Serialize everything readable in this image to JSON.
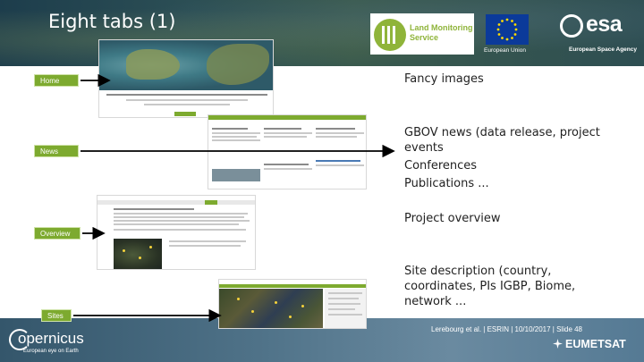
{
  "slide": {
    "title": "Eight tabs (1)"
  },
  "logos": {
    "land_monitoring_line1": "Land Monitoring",
    "land_monitoring_line2": "Service",
    "eu_caption": "European Union",
    "esa_text": "esa",
    "esa_caption": "European Space Agency",
    "copernicus_text": "opernicus",
    "copernicus_caption": "European eye on Earth",
    "eumetsat_text": "EUMETSAT"
  },
  "tabs": {
    "home": "Home",
    "news": "News",
    "overview": "Overview",
    "sites": "Sites"
  },
  "screenshots": {
    "home_heading": "Ground-Based Observations for Validation (GBOV) of Copernicus Global Land Products",
    "logo_label": "Copernicus"
  },
  "descriptions": {
    "home": "Fancy images",
    "news_line1": "GBOV news (data release, project",
    "news_line2": "events",
    "news_line3": "Conferences",
    "news_line4": "Publications ...",
    "overview": "Project overview",
    "sites_line1": "Site description (country,",
    "sites_line2": "coordinates, PIs IGBP, Biome,",
    "sites_line3": "network ..."
  },
  "footer": {
    "text": "Lerebourg et al. | ESRIN | 10/10/2017 | Slide  48"
  },
  "colors": {
    "tab_green": "#7daa2f",
    "band_dark": "#1d3d4c",
    "text_dark": "#222222"
  }
}
